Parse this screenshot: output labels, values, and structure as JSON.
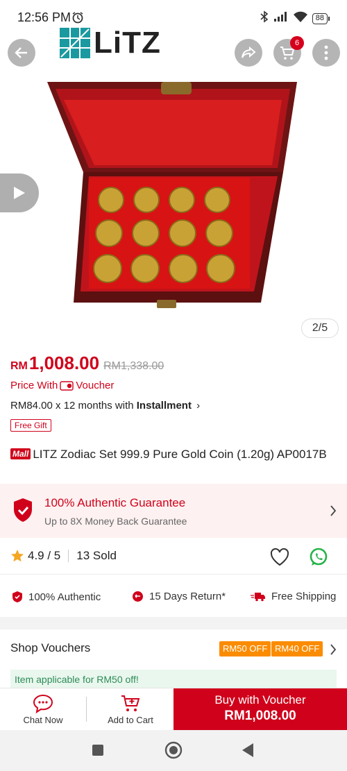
{
  "status_bar": {
    "time": "12:56 PM",
    "battery": "88"
  },
  "header": {
    "brand": "LiTZ",
    "cart_count": "6"
  },
  "gallery": {
    "page_indicator": "2/5"
  },
  "price": {
    "currency": "RM",
    "value": "1,008.00",
    "original": "RM1,338.00",
    "voucher_prefix": "Price With",
    "voucher_label": "Voucher",
    "installment_text": "RM84.00 x 12 months with ",
    "installment_label": "Installment",
    "gift_tag": "Free Gift"
  },
  "product": {
    "mall_badge": "Mall",
    "title": "LITZ Zodiac Set 999.9 Pure Gold Coin (1.20g) AP0017B"
  },
  "guarantee": {
    "title": "100% Authentic Guarantee",
    "subtitle": "Up to 8X Money Back Guarantee"
  },
  "rating": {
    "score": "4.9 / 5",
    "sold": "13 Sold"
  },
  "features": [
    {
      "label": "100% Authentic"
    },
    {
      "label": "15 Days Return*"
    },
    {
      "label": "Free Shipping"
    }
  ],
  "vouchers": {
    "label": "Shop Vouchers",
    "chips": [
      "RM50 OFF",
      "RM40 OFF"
    ],
    "applicable": "Item applicable for RM50 off!"
  },
  "bottom_bar": {
    "chat": "Chat Now",
    "add_cart": "Add to Cart",
    "buy_line1": "Buy with Voucher",
    "buy_line2": "RM1,008.00"
  },
  "colors": {
    "accent": "#d0021b",
    "voucher_chip": "#fb8c00",
    "brand_teal": "#1a9aa0"
  }
}
